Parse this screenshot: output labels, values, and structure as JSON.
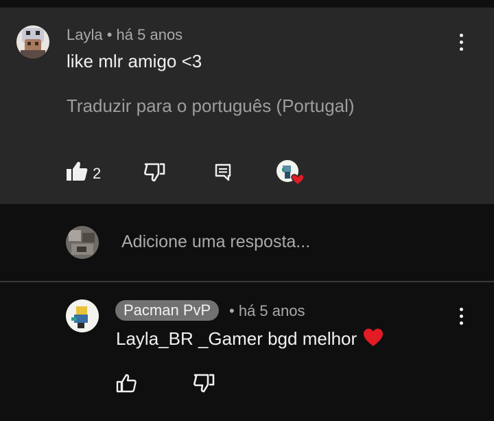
{
  "comment": {
    "author": "Layla",
    "time": "há 5 anos",
    "text": "like mlr amigo <3",
    "translate_label": "Traduzir para o português (Portugal)",
    "like_count": "2",
    "icons": {
      "like": "thumbs-up-filled-icon",
      "dislike": "thumbs-down-outline-icon",
      "reply": "reply-comment-icon",
      "creator_heart": "creator-heart-icon",
      "menu": "more-vertical-icon"
    }
  },
  "reply_input": {
    "placeholder": "Adicione uma resposta..."
  },
  "reply": {
    "author": "Pacman PvP",
    "time": "há 5 anos",
    "text": "Layla_BR _Gamer bgd melhor"
  },
  "colors": {
    "comment_bg": "#282828",
    "page_bg": "#0f0f0f",
    "heart": "#e21b25",
    "chip_bg": "#717171"
  }
}
